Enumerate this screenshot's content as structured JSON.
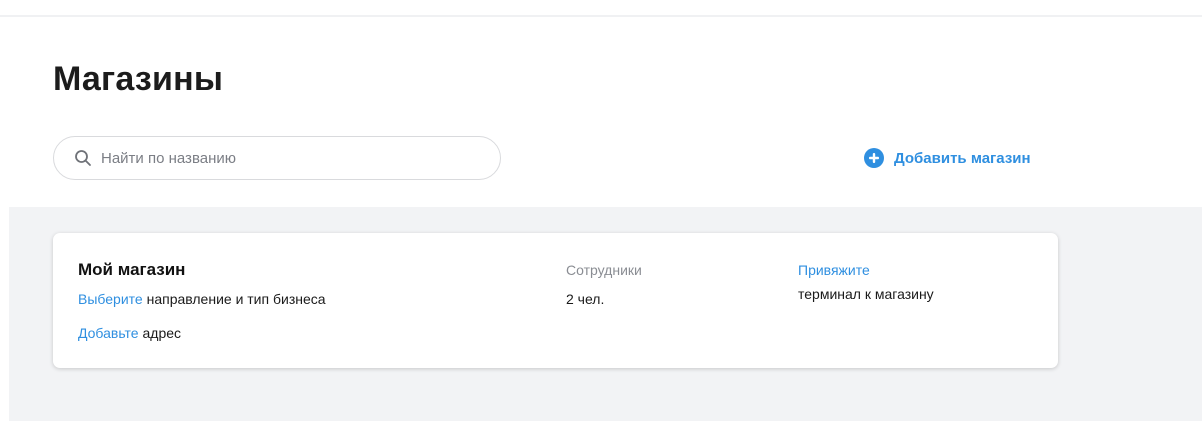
{
  "page": {
    "title": "Магазины"
  },
  "search": {
    "placeholder": "Найти по названию",
    "value": "",
    "icon": "search-icon"
  },
  "add_store": {
    "label": "Добавить магазин",
    "icon": "plus-circle-icon",
    "color": "#2f8fe0"
  },
  "stores": [
    {
      "name": "Мой магазин",
      "business_link": "Выберите",
      "business_text": "направление и тип бизнеса",
      "address_link": "Добавьте",
      "address_text": "адрес",
      "employees_label": "Сотрудники",
      "employees_count": "2 чел.",
      "terminal_link": "Привяжите",
      "terminal_text": "терминал к магазину"
    }
  ],
  "colors": {
    "accent": "#2f8fe0",
    "content_background": "#f2f3f5"
  }
}
